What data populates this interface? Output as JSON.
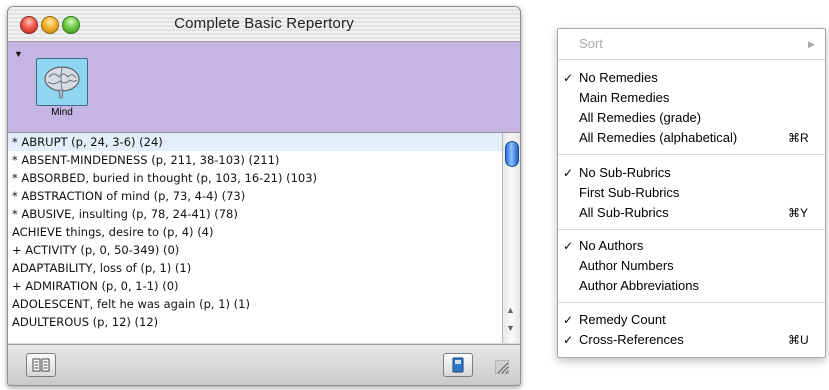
{
  "window": {
    "title": "Complete Basic Repertory",
    "icon_label": "Mind",
    "rows": [
      "* ABRUPT (p, 24, 3-6) (24)",
      "* ABSENT-MINDEDNESS (p, 211, 38-103) (211)",
      "* ABSORBED, buried in thought (p, 103, 16-21) (103)",
      "* ABSTRACTION of mind (p, 73, 4-4) (73)",
      "* ABUSIVE, insulting (p, 78, 24-41) (78)",
      "ACHIEVE things, desire to (p, 4) (4)",
      "+ ACTIVITY (p, 0, 50-349) (0)",
      "ADAPTABILITY, loss of (p, 1) (1)",
      "+ ADMIRATION (p, 0, 1-1) (0)",
      "ADOLESCENT, felt he was again (p, 1) (1)",
      "ADULTEROUS (p, 12) (12)"
    ]
  },
  "menu": {
    "sort": {
      "label": "Sort",
      "arrow": "▶"
    },
    "check": "✓",
    "items": [
      {
        "label": "No Remedies",
        "checked": true,
        "shortcut": ""
      },
      {
        "label": "Main Remedies",
        "checked": false,
        "shortcut": ""
      },
      {
        "label": "All Remedies (grade)",
        "checked": false,
        "shortcut": ""
      },
      {
        "label": "All Remedies (alphabetical)",
        "checked": false,
        "shortcut": "⌘R"
      },
      {
        "label": "No Sub-Rubrics",
        "checked": true,
        "shortcut": ""
      },
      {
        "label": "First Sub-Rubrics",
        "checked": false,
        "shortcut": ""
      },
      {
        "label": "All Sub-Rubrics",
        "checked": false,
        "shortcut": "⌘Y"
      },
      {
        "label": "No Authors",
        "checked": true,
        "shortcut": ""
      },
      {
        "label": "Author Numbers",
        "checked": false,
        "shortcut": ""
      },
      {
        "label": "Author Abbreviations",
        "checked": false,
        "shortcut": ""
      },
      {
        "label": "Remedy Count",
        "checked": true,
        "shortcut": ""
      },
      {
        "label": "Cross-References",
        "checked": true,
        "shortcut": "⌘U"
      }
    ]
  }
}
